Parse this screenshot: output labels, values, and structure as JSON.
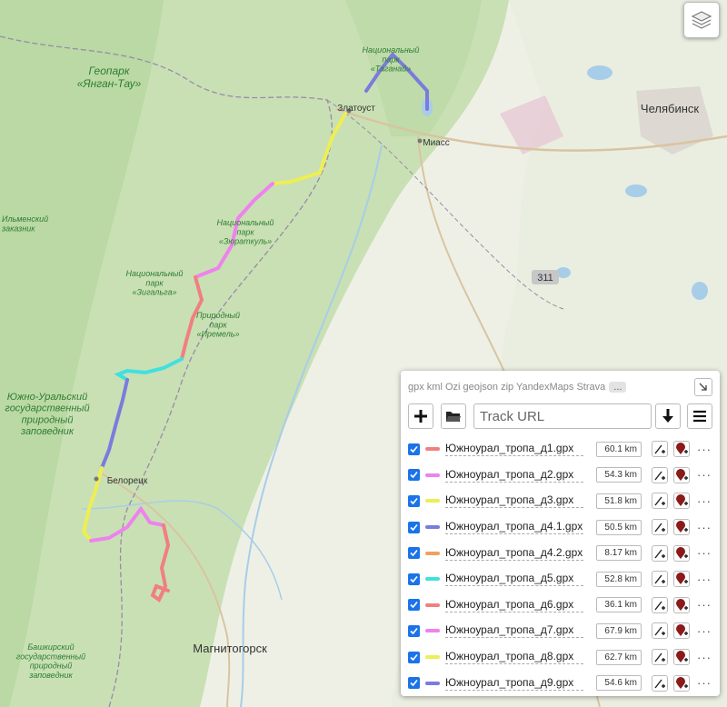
{
  "map": {
    "places": [
      {
        "key": "yangan",
        "text": "Геопарк «Янган-Тау»"
      },
      {
        "key": "taganay",
        "text": "Национальный парк «Таганай»"
      },
      {
        "key": "zlatoust",
        "text": "Златоуст"
      },
      {
        "key": "miass",
        "text": "Миасс"
      },
      {
        "key": "chelyabinsk",
        "text": "Челябинск"
      },
      {
        "key": "zyuratkul",
        "text": "Национальный парк «Зюраткуль»"
      },
      {
        "key": "zigalga",
        "text": "Национальный парк «Зигальга»"
      },
      {
        "key": "iremel",
        "text": "Природный парк «Иремель»"
      },
      {
        "key": "ilmen",
        "text": "Ильменский заказник"
      },
      {
        "key": "yuzhno",
        "text": "Южно-Уральский государственный природный заповедник"
      },
      {
        "key": "beloretsk",
        "text": "Белорецк"
      },
      {
        "key": "bashkir",
        "text": "Башкирский государственный природный заповедник"
      },
      {
        "key": "magnitogorsk",
        "text": "Магнитогорск"
      }
    ],
    "road_shield": "311",
    "layers_icon": "layers-icon"
  },
  "panel": {
    "formats": "gpx kml Ozi geojson zip YandexMaps Strava",
    "formats_more": "...",
    "url_placeholder": "Track URL",
    "tracks": [
      {
        "name": "Южноурал_тропа_д1.gpx",
        "distance": "60.1 km",
        "color": "#f08080"
      },
      {
        "name": "Южноурал_тропа_д2.gpx",
        "distance": "54.3 km",
        "color": "#ee82ee"
      },
      {
        "name": "Южноурал_тропа_д3.gpx",
        "distance": "51.8 km",
        "color": "#eeee55"
      },
      {
        "name": "Южноурал_тропа_д4.1.gpx",
        "distance": "50.5 km",
        "color": "#7b7bdd"
      },
      {
        "name": "Южноурал_тропа_д4.2.gpx",
        "distance": "8.17 km",
        "color": "#f0a060"
      },
      {
        "name": "Южноурал_тропа_д5.gpx",
        "distance": "52.8 km",
        "color": "#40e0e0"
      },
      {
        "name": "Южноурал_тропа_д6.gpx",
        "distance": "36.1 km",
        "color": "#f08080"
      },
      {
        "name": "Южноурал_тропа_д7.gpx",
        "distance": "67.9 km",
        "color": "#ee82ee"
      },
      {
        "name": "Южноурал_тропа_д8.gpx",
        "distance": "62.7 km",
        "color": "#eeee55"
      },
      {
        "name": "Южноурал_тропа_д9.gpx",
        "distance": "54.6 km",
        "color": "#7b7bdd"
      }
    ]
  }
}
